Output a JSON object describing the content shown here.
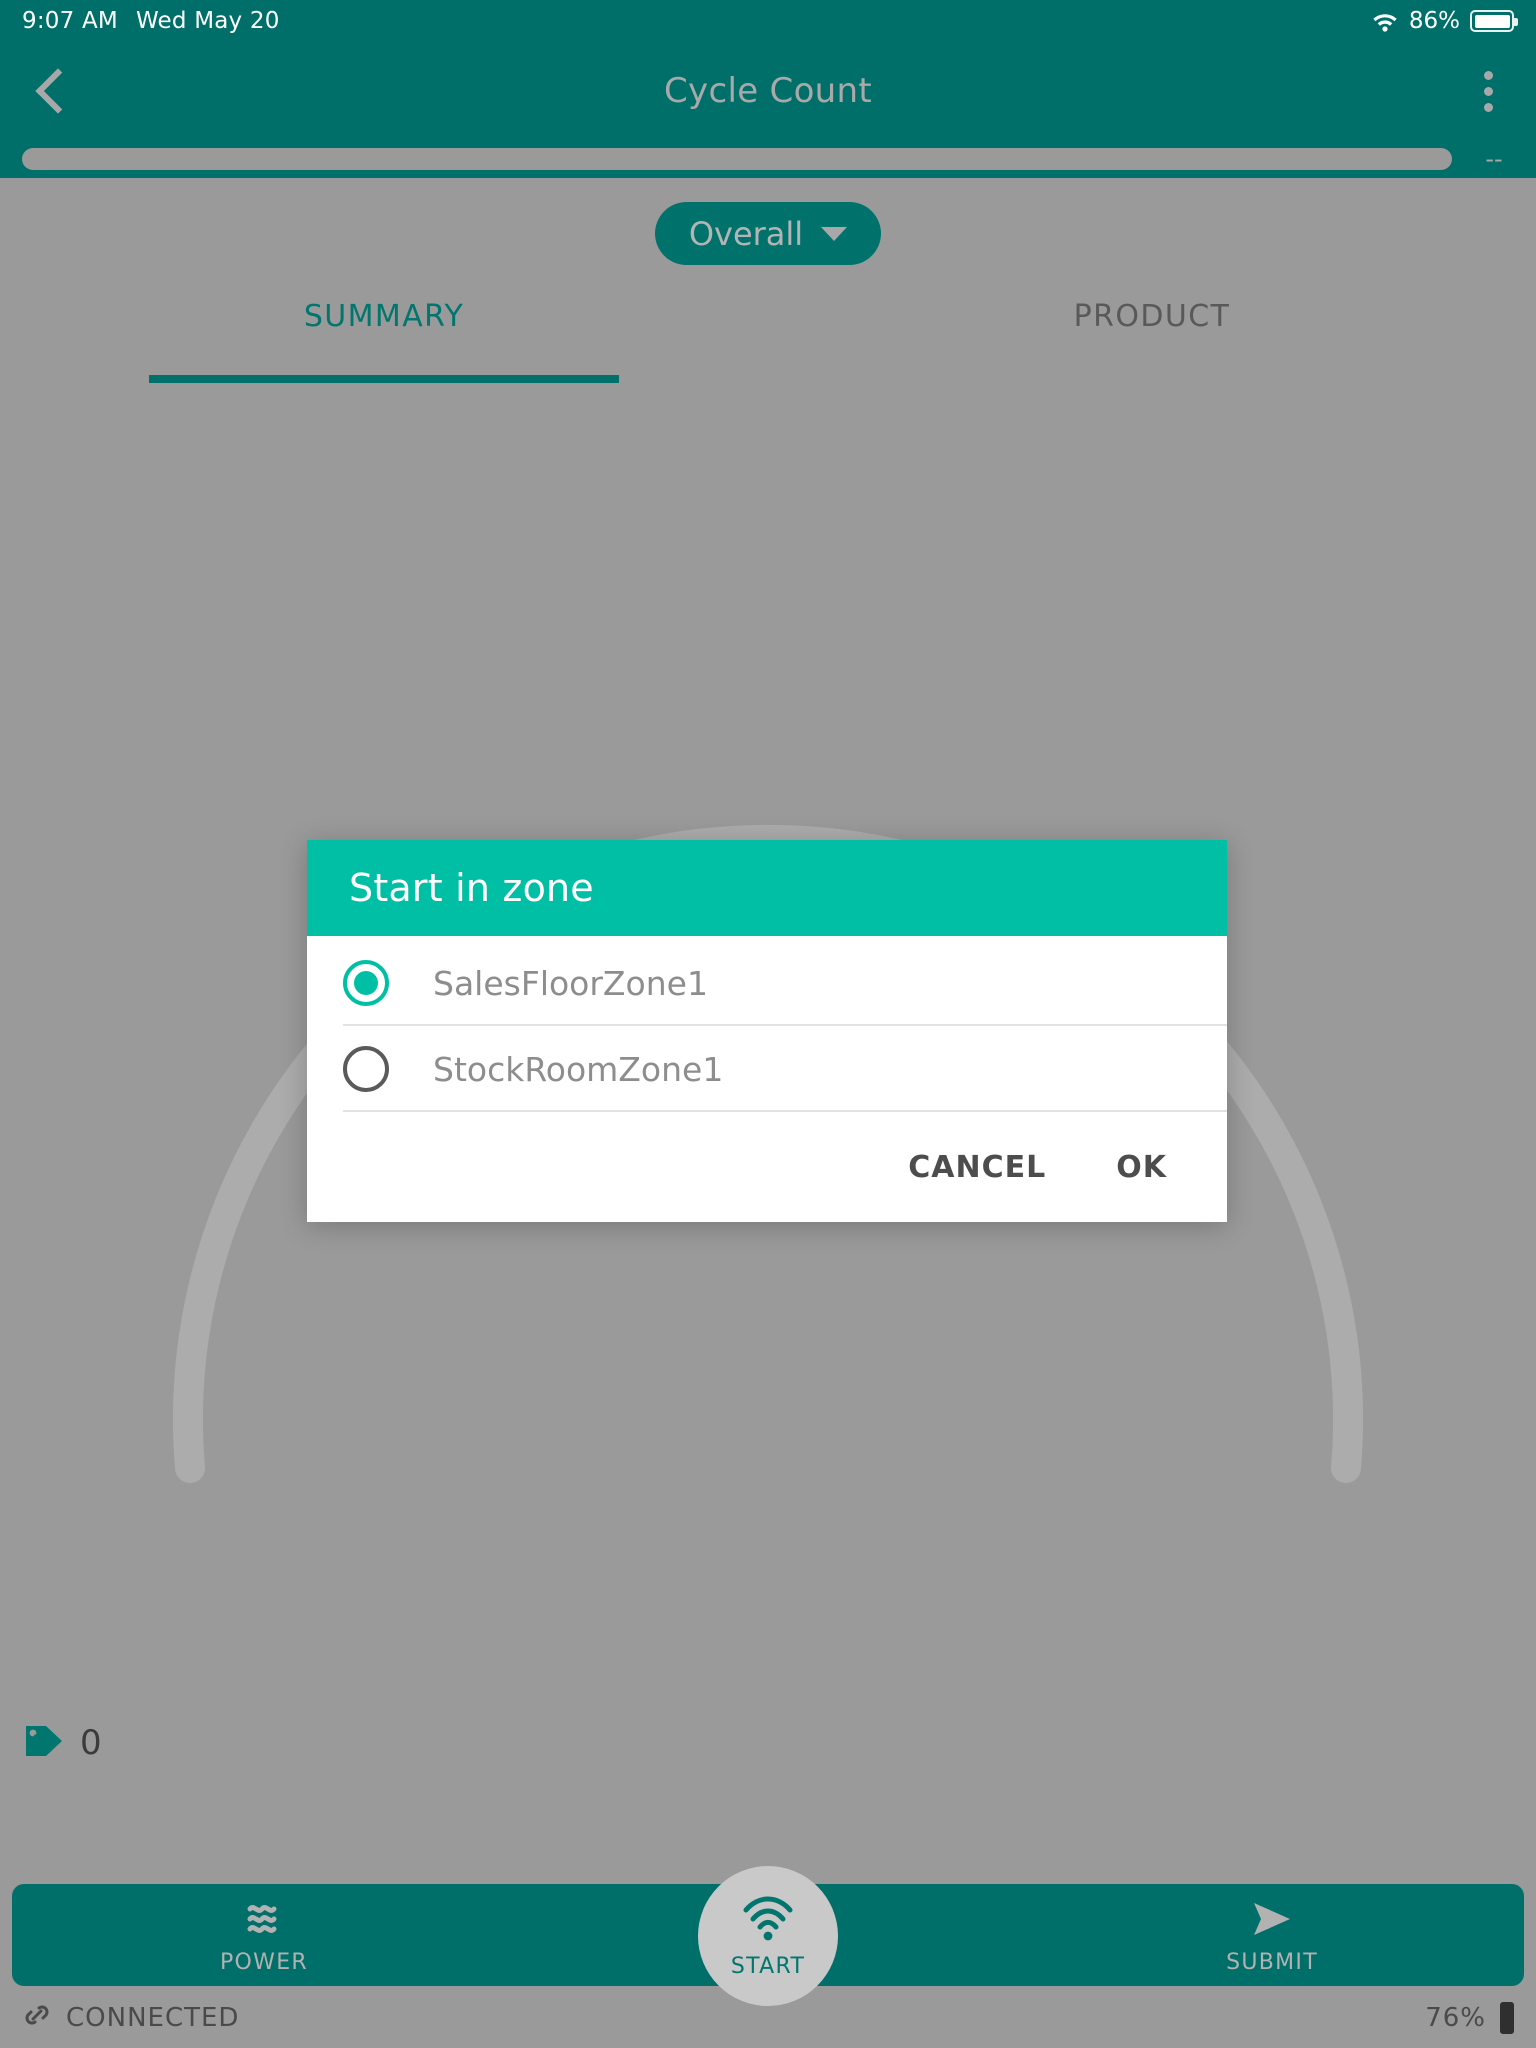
{
  "status_bar": {
    "time": "9:07 AM",
    "date": "Wed May 20",
    "wifi_icon": "wifi-icon",
    "battery_percent": "86%",
    "battery_icon": "battery-icon"
  },
  "app_bar": {
    "back_icon": "back-chevron-icon",
    "title": "Cycle Count",
    "overflow_icon": "overflow-menu-icon"
  },
  "progress": {
    "value_label": "--"
  },
  "filter": {
    "selected": "Overall",
    "caret_icon": "chevron-down-icon"
  },
  "tabs": [
    {
      "label": "SUMMARY",
      "active": true
    },
    {
      "label": "PRODUCT",
      "active": false
    }
  ],
  "tag_counter": {
    "icon": "tag-plus-icon",
    "count": "0"
  },
  "bottom_nav": {
    "items": [
      {
        "label": "POWER",
        "icon": "power-waves-icon"
      },
      {
        "label": "SUBMIT",
        "icon": "send-arrow-icon"
      }
    ],
    "center": {
      "label": "START",
      "icon": "rfid-wifi-icon"
    }
  },
  "footer_status": {
    "connection_icon": "link-icon",
    "connection_text": "CONNECTED",
    "battery_percent": "76%",
    "battery_icon": "battery-small-icon"
  },
  "dialog": {
    "title": "Start in zone",
    "options": [
      {
        "label": "SalesFloorZone1",
        "selected": true
      },
      {
        "label": "StockRoomZone1",
        "selected": false
      }
    ],
    "cancel_label": "CANCEL",
    "ok_label": "OK"
  },
  "colors": {
    "app_bar_teal": "#006F69",
    "dialog_header_teal": "#00BFA5",
    "accent_teal": "#00766F",
    "scrim_gray": "#9a9a9a"
  }
}
